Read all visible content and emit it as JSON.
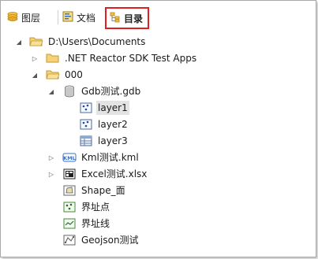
{
  "tabs": [
    {
      "id": "layers",
      "label": "图层",
      "icon": "layers-icon"
    },
    {
      "id": "docs",
      "label": "文档",
      "icon": "document-icon"
    },
    {
      "id": "catalog",
      "label": "目录",
      "icon": "catalog-icon",
      "active": true
    }
  ],
  "tree": [
    {
      "label": "D:\\Users\\Documents",
      "icon": "folder-open-icon",
      "expanded": true
    },
    {
      "label": ".NET Reactor SDK Test Apps",
      "icon": "folder-icon",
      "expanded": false
    },
    {
      "label": "000",
      "icon": "folder-open-icon",
      "expanded": true
    },
    {
      "label": "Gdb测试.gdb",
      "icon": "database-icon",
      "expanded": true
    },
    {
      "label": "layer1",
      "icon": "point-layer-icon",
      "selected": true
    },
    {
      "label": "layer2",
      "icon": "point-layer-icon"
    },
    {
      "label": "layer3",
      "icon": "table-icon"
    },
    {
      "label": "Kml测试.kml",
      "icon": "kml-icon",
      "expanded": false
    },
    {
      "label": "Excel测试.xlsx",
      "icon": "excel-icon",
      "expanded": false
    },
    {
      "label": "Shape_面",
      "icon": "polygon-layer-icon"
    },
    {
      "label": "界址点",
      "icon": "point-layer-green-icon"
    },
    {
      "label": "界址线",
      "icon": "line-layer-icon"
    },
    {
      "label": "Geojson测试",
      "icon": "geojson-icon"
    }
  ],
  "colors": {
    "active_tab_border": "#e02020",
    "folder": "#e8b84a",
    "selection": "#e3e3e3"
  }
}
